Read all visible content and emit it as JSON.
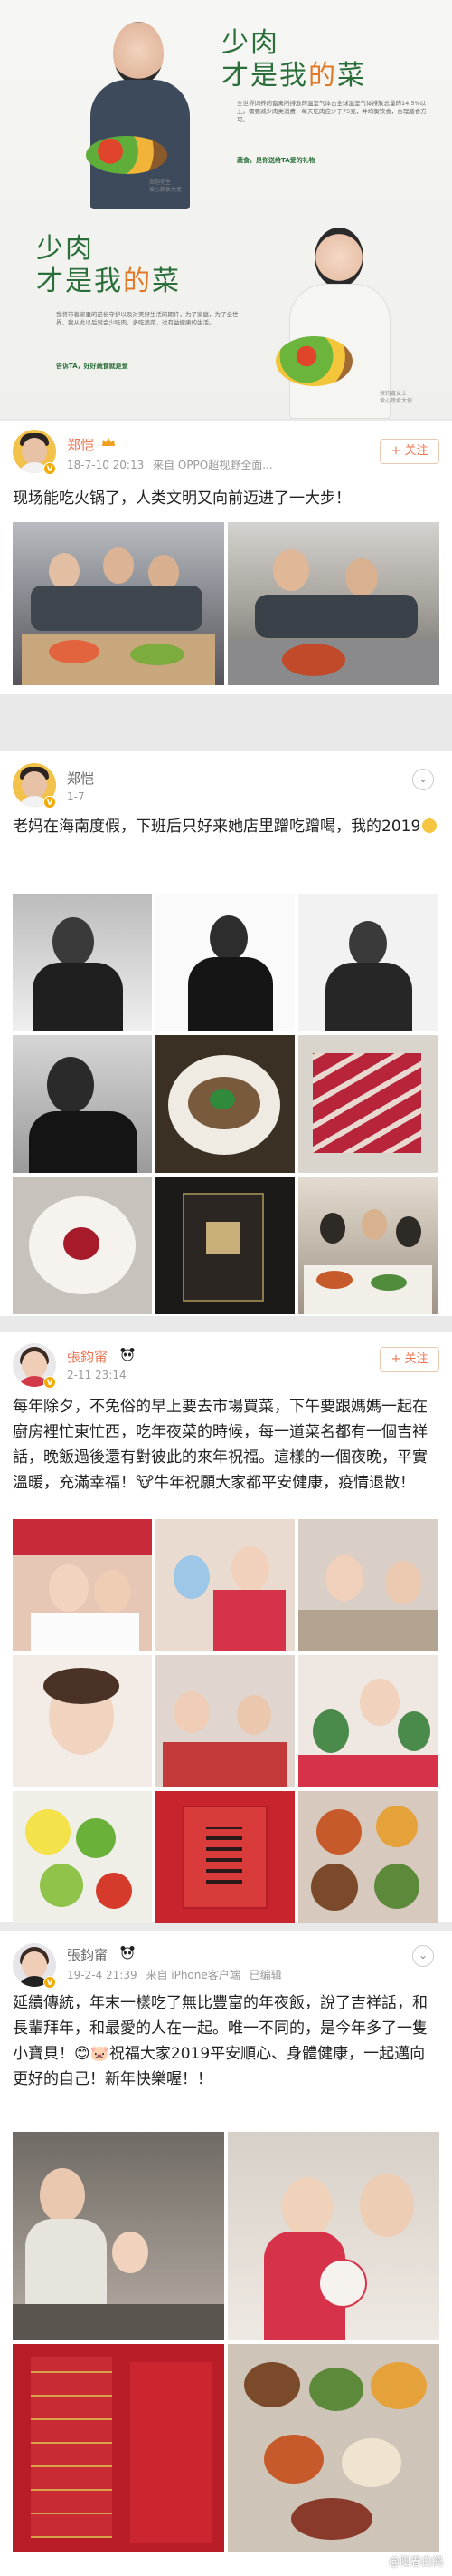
{
  "ad": {
    "headline_line1": "少肉",
    "headline_line2_pre": "才是我",
    "headline_heart": "的",
    "headline_line2_post": "菜",
    "body_top": "全世界饲养的畜禽所排放的温室气体占全球温室气体排放总量的14.5%以上。需要减少肉类消费，每天吃肉应少于75克，并均衡饮食，合理膳食方可。",
    "slogan_top": "蔬食，是你送给TA爱的礼物",
    "body_bottom": "我将带着家里的这份守护以及对美好生活的期许，为了家庭，为了全世界，我从此以后就会少吃肉，多吃蔬菜，过有益健康的生活。",
    "slogan_bottom": "告诉TA，好好蔬食就是爱",
    "caption_top": "郑恺先生\n爱心蔬食大使",
    "caption_bottom": "张钧甯女士\n爱心蔬食大使"
  },
  "posts": [
    {
      "username": "郑恺",
      "meta_time": "18-7-10 20:13",
      "meta_source": "来自 OPPO超视野全面...",
      "follow_label": "+ 关注",
      "text": "现场能吃火锅了，人类文明又向前迈进了一大步！"
    },
    {
      "username": "郑恺",
      "meta_time": "1-7",
      "text_main": "老妈在海南度假，下班后只好来她店里蹭吃蹭喝，我的2019",
      "more_label": "⌄"
    },
    {
      "username": "張鈞甯",
      "meta_time": "2-11 23:14",
      "follow_label": "+ 关注",
      "text": "每年除夕，不免俗的早上要去市場買菜，下午要跟媽媽一起在廚房裡忙東忙西，吃年夜菜的時候，每一道菜名都有一個吉祥話，晚飯過後還有對彼此的來年祝福。這樣的一個夜晚，平實溫暖，充滿幸福！🐮牛年祝願大家都平安健康，疫情退散！"
    },
    {
      "username": "張鈞甯",
      "meta_time": "19-2-4 21:39",
      "meta_source": "来自 iPhone客户端",
      "meta_status": "已编辑",
      "more_label": "⌄",
      "text": "延續傳統，年末一樣吃了無比豐富的年夜飯，說了吉祥話，和長輩拜年，和最愛的人在一起。唯一不同的，是今年多了一隻小寶貝！😊🐷祝福大家2019平安順心、身體健康，一起邁向更好的自己！新年快樂喔！！",
      "watermark": "@阳春白鸽"
    }
  ],
  "colors": {
    "accent_name": "#eb7350",
    "ad_green": "#2a6f3a",
    "meta_gray": "#9a9a9a"
  },
  "icons": {
    "verified": "v-badge-icon",
    "crown": "crown-icon",
    "more": "chevron-down-icon"
  }
}
